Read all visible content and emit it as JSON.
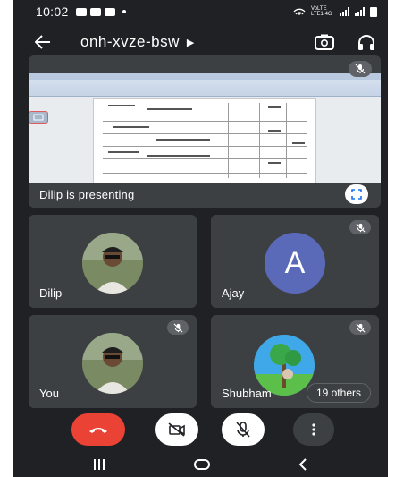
{
  "status_bar": {
    "time": "10:02",
    "network_label": "VoLTE LTE1 4G"
  },
  "meeting": {
    "code": "onh-xvze-bsw"
  },
  "presentation": {
    "label": "Dilip is presenting"
  },
  "participants": [
    {
      "name": "Dilip",
      "avatar": "photo",
      "muted": false
    },
    {
      "name": "Ajay",
      "avatar": "letter",
      "initial": "A",
      "muted": true
    },
    {
      "name": "You",
      "avatar": "photo",
      "muted": true
    },
    {
      "name": "Shubham",
      "avatar": "photo",
      "muted": true
    }
  ],
  "others": {
    "label": "19 others"
  },
  "controls": {
    "end_call": "end-call",
    "camera": "camera-off",
    "microphone": "microphone-off",
    "more": "more-options"
  },
  "colors": {
    "end_call": "#ea4335",
    "background": "#202124",
    "tile": "#3c4043",
    "avatar_letter": "#5b6ab8"
  }
}
